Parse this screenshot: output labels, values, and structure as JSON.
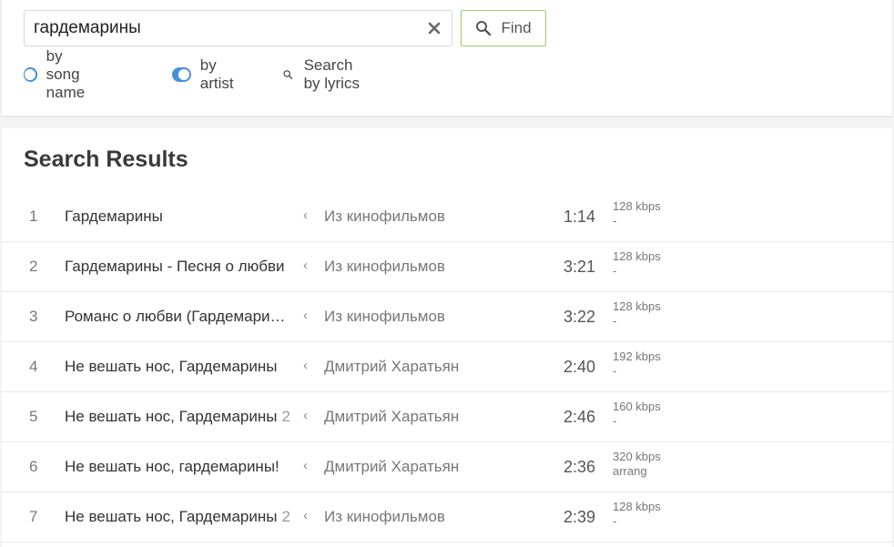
{
  "search": {
    "query": "гардемарины",
    "find_label": "Find"
  },
  "options": {
    "by_song_name": "by song name",
    "by_artist": "by artist",
    "search_by_lyrics": "Search by lyrics"
  },
  "results": {
    "title": "Search Results",
    "tracks": [
      {
        "num": "1",
        "title": "Гардемарины",
        "version": "",
        "artist": "Из кинофильмов",
        "duration": "1:14",
        "bitrate": "128 kbps",
        "note": "-"
      },
      {
        "num": "2",
        "title": "Гардемарины - Песня о любви",
        "version": "",
        "artist": "Из кинофильмов",
        "duration": "3:21",
        "bitrate": "128 kbps",
        "note": "-"
      },
      {
        "num": "3",
        "title": "Романс о любви (Гардемарины, вперёд!)",
        "version": "",
        "artist": "Из кинофильмов",
        "duration": "3:22",
        "bitrate": "128 kbps",
        "note": "-"
      },
      {
        "num": "4",
        "title": "Не вешать нос, Гардемарины",
        "version": "",
        "artist": "Дмитрий Харатьян",
        "duration": "2:40",
        "bitrate": "192 kbps",
        "note": "-"
      },
      {
        "num": "5",
        "title": "Не вешать нос, Гардемарины",
        "version": "2",
        "artist": "Дмитрий Харатьян",
        "duration": "2:46",
        "bitrate": "160 kbps",
        "note": "-"
      },
      {
        "num": "6",
        "title": "Не вешать нос, гардемарины!",
        "version": "",
        "artist": "Дмитрий Харатьян",
        "duration": "2:36",
        "bitrate": "320 kbps",
        "note": "arrang"
      },
      {
        "num": "7",
        "title": "Не вешать нос, Гардемарины",
        "version": "2",
        "artist": "Из кинофильмов",
        "duration": "2:39",
        "bitrate": "128 kbps",
        "note": "-"
      }
    ]
  }
}
